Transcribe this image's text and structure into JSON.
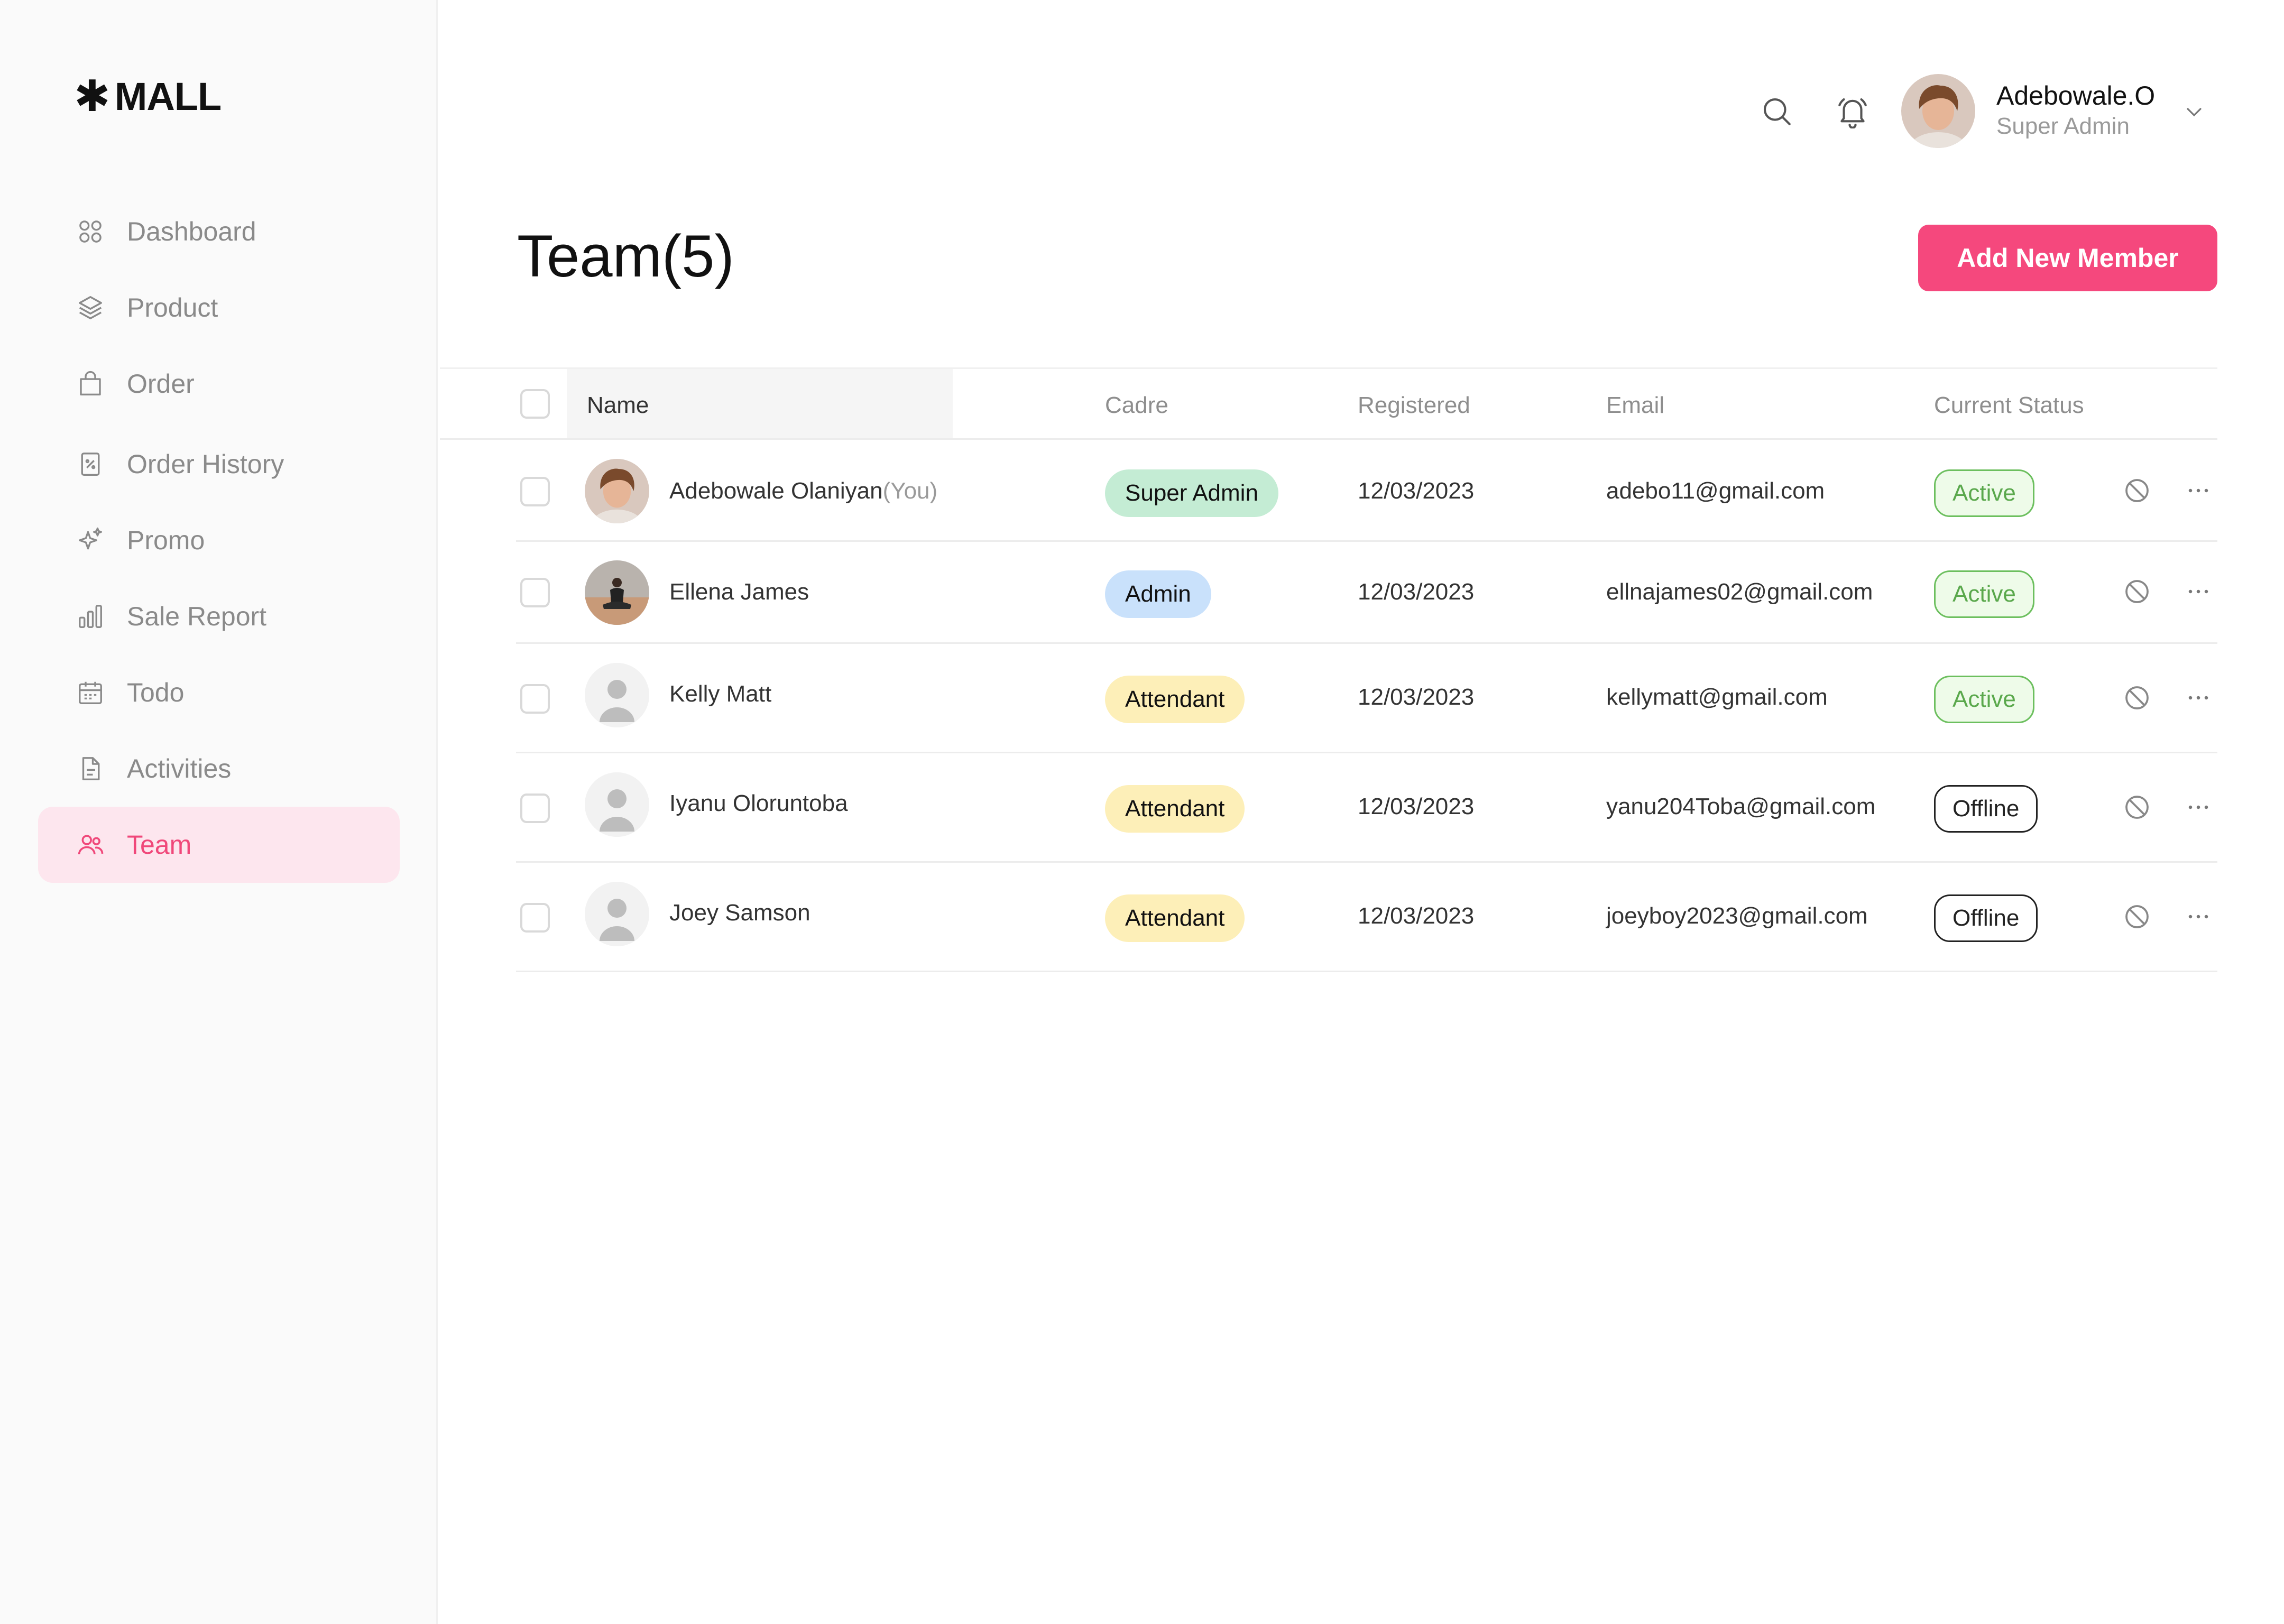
{
  "brand": {
    "mark": "✱",
    "name": "MALL"
  },
  "sidebar": {
    "items": [
      {
        "label": "Dashboard",
        "icon": "grid-icon"
      },
      {
        "label": "Product",
        "icon": "layers-icon"
      },
      {
        "label": "Order",
        "icon": "bag-icon"
      },
      {
        "label": "Order History",
        "icon": "receipt-icon"
      },
      {
        "label": "Promo",
        "icon": "sparkle-icon"
      },
      {
        "label": "Sale Report",
        "icon": "bar-chart-icon"
      },
      {
        "label": "Todo",
        "icon": "calendar-icon"
      },
      {
        "label": "Activities",
        "icon": "document-icon"
      },
      {
        "label": "Team",
        "icon": "users-icon",
        "active": true
      }
    ]
  },
  "header": {
    "user_name": "Adebowale.O",
    "user_role": "Super Admin"
  },
  "page": {
    "title": "Team(5)",
    "add_button": "Add New Member"
  },
  "table": {
    "columns": {
      "name": "Name",
      "cadre": "Cadre",
      "registered": "Registered",
      "email": "Email",
      "status": "Current Status"
    },
    "rows": [
      {
        "name": "Adebowale Olaniyan",
        "suffix": "(You)",
        "cadre": "Super Admin",
        "registered": "12/03/2023",
        "email": "adebo11@gmail.com",
        "status": "Active"
      },
      {
        "name": "Ellena James",
        "suffix": "",
        "cadre": "Admin",
        "registered": "12/03/2023",
        "email": "ellnajames02@gmail.com",
        "status": "Active"
      },
      {
        "name": "Kelly Matt",
        "suffix": "",
        "cadre": "Attendant",
        "registered": "12/03/2023",
        "email": "kellymatt@gmail.com",
        "status": "Active"
      },
      {
        "name": "Iyanu Oloruntoba",
        "suffix": "",
        "cadre": "Attendant",
        "registered": "12/03/2023",
        "email": "yanu204Toba@gmail.com",
        "status": "Offline"
      },
      {
        "name": "Joey Samson",
        "suffix": "",
        "cadre": "Attendant",
        "registered": "12/03/2023",
        "email": "joeyboy2023@gmail.com",
        "status": "Offline"
      }
    ]
  },
  "colors": {
    "accent": "#f5487d",
    "badge_super_admin": "#c4ecd4",
    "badge_admin": "#c9e1fb",
    "badge_attendant": "#fdefb8",
    "status_active": "#5aa84c"
  }
}
